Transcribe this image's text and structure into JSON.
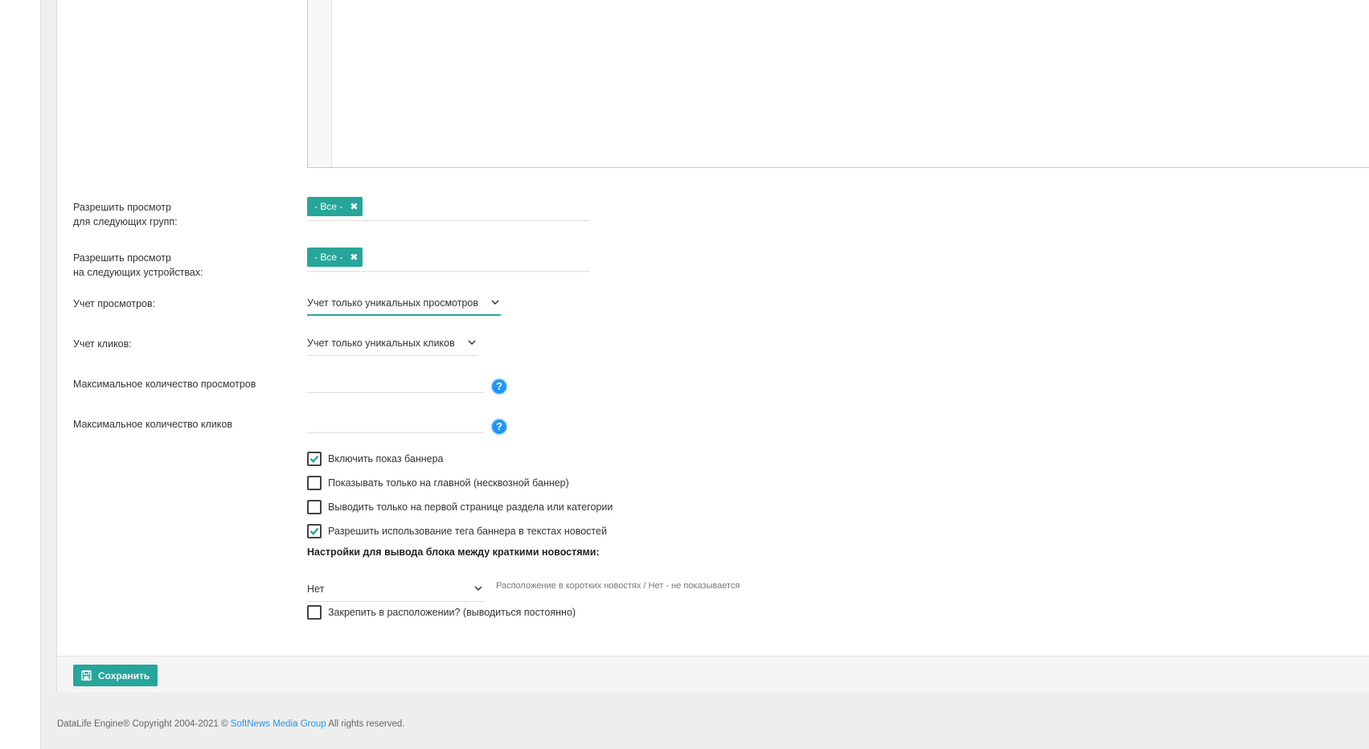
{
  "form": {
    "groups_label_line1": "Разрешить просмотр",
    "groups_label_line2": "для следующих групп:",
    "groups_tag": "- Все -",
    "devices_label_line1": "Разрешить просмотр",
    "devices_label_line2": "на следующих устройствах:",
    "devices_tag": "- Все -",
    "views_count_label": "Учет просмотров:",
    "views_count_value": "Учет только уникальных просмотров",
    "clicks_count_label": "Учет кликов:",
    "clicks_count_value": "Учет только уникальных кликов",
    "max_views_label": "Максимальное количество просмотров",
    "max_views_value": "",
    "max_clicks_label": "Максимальное количество кликов",
    "max_clicks_value": "",
    "help_glyph": "?",
    "checkboxes": [
      {
        "label": "Включить показ баннера",
        "checked": true
      },
      {
        "label": "Показывать только на главной (несквозной баннер)",
        "checked": false
      },
      {
        "label": "Выводить только на первой странице раздела или категории",
        "checked": false
      },
      {
        "label": "Разрешить использование тега баннера в текстах новостей",
        "checked": true
      }
    ],
    "block_section_title": "Настройки для вывода блока между краткими новостями:",
    "position_value": "Нет",
    "position_hint": "Расположение в коротких новостях / Нет - не показывается",
    "pin_label": "Закрепить в расположении? (выводиться постоянно)",
    "pin_checked": false
  },
  "footer": {
    "save_label": "Сохранить",
    "copyright_prefix": "DataLife Engine® Copyright 2004-2021 ©",
    "copyright_link": "SoftNews Media Group",
    "copyright_suffix": "All rights reserved."
  },
  "colors": {
    "accent": "#26a69a",
    "help": "#2196f3"
  }
}
